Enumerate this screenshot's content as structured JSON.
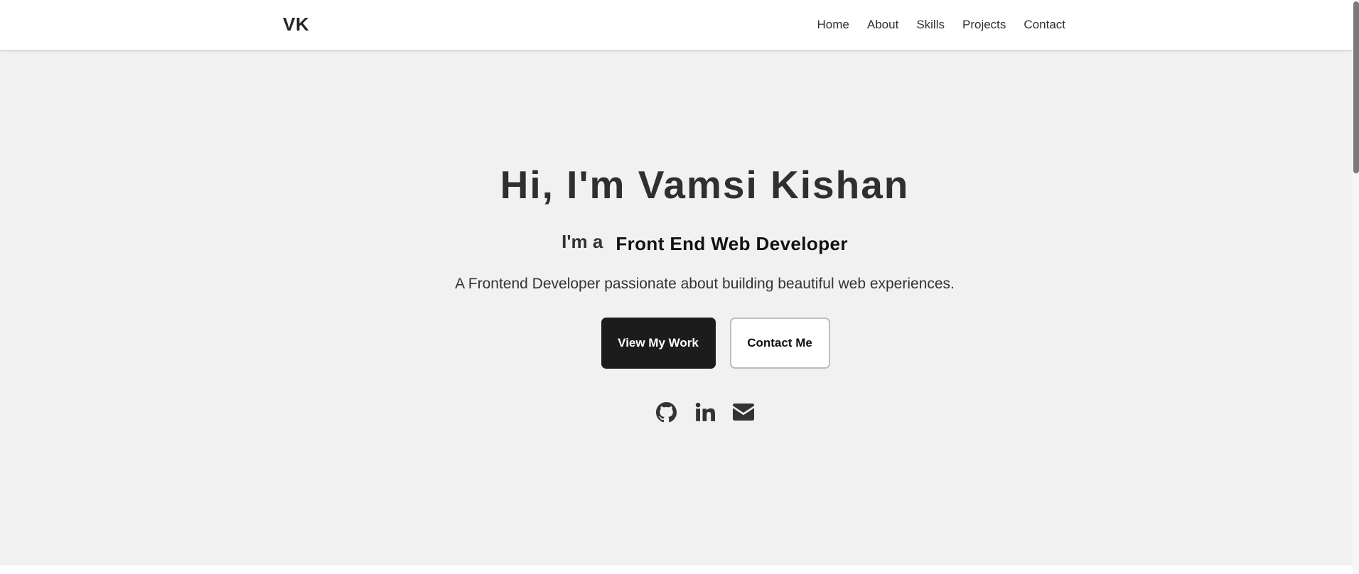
{
  "header": {
    "logo": "VK",
    "nav": [
      {
        "label": "Home"
      },
      {
        "label": "About"
      },
      {
        "label": "Skills"
      },
      {
        "label": "Projects"
      },
      {
        "label": "Contact"
      }
    ]
  },
  "hero": {
    "title": "Hi, I'm Vamsi Kishan",
    "role_prefix": "I'm a",
    "role": "Front End Web Developer",
    "subtitle": "A Frontend Developer passionate about building beautiful web experiences.",
    "primary_button": "View My Work",
    "secondary_button": "Contact Me",
    "social_icons": [
      "github-icon",
      "linkedin-icon",
      "envelope-icon"
    ]
  },
  "colors": {
    "hero_background": "#f1f1f1",
    "primary_button": "#1c1c1c",
    "text": "#2f2f2f"
  }
}
